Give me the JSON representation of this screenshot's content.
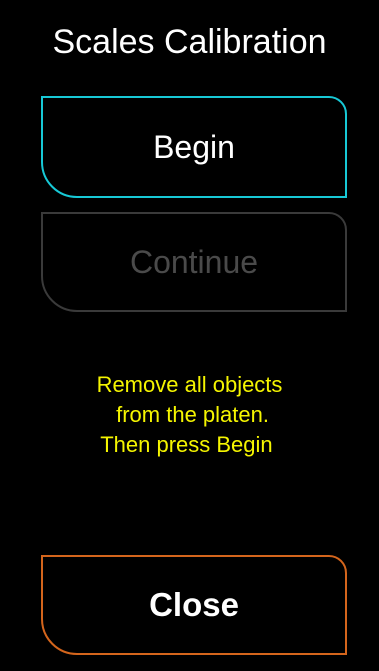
{
  "dialog": {
    "title": "Scales Calibration"
  },
  "buttons": {
    "begin_label": "Begin",
    "continue_label": "Continue",
    "close_label": "Close"
  },
  "instructions": {
    "lines": [
      "Remove all objects",
      " from the platen.",
      "Then press Begin "
    ]
  },
  "colors": {
    "background": "#000000",
    "begin_border": "#17c9d6",
    "continue_border_disabled": "#3a3a3a",
    "continue_text_disabled": "#4a4a4a",
    "close_border": "#d4651c",
    "instruction_text": "#f5f500"
  },
  "state": {
    "continue_enabled": false
  }
}
